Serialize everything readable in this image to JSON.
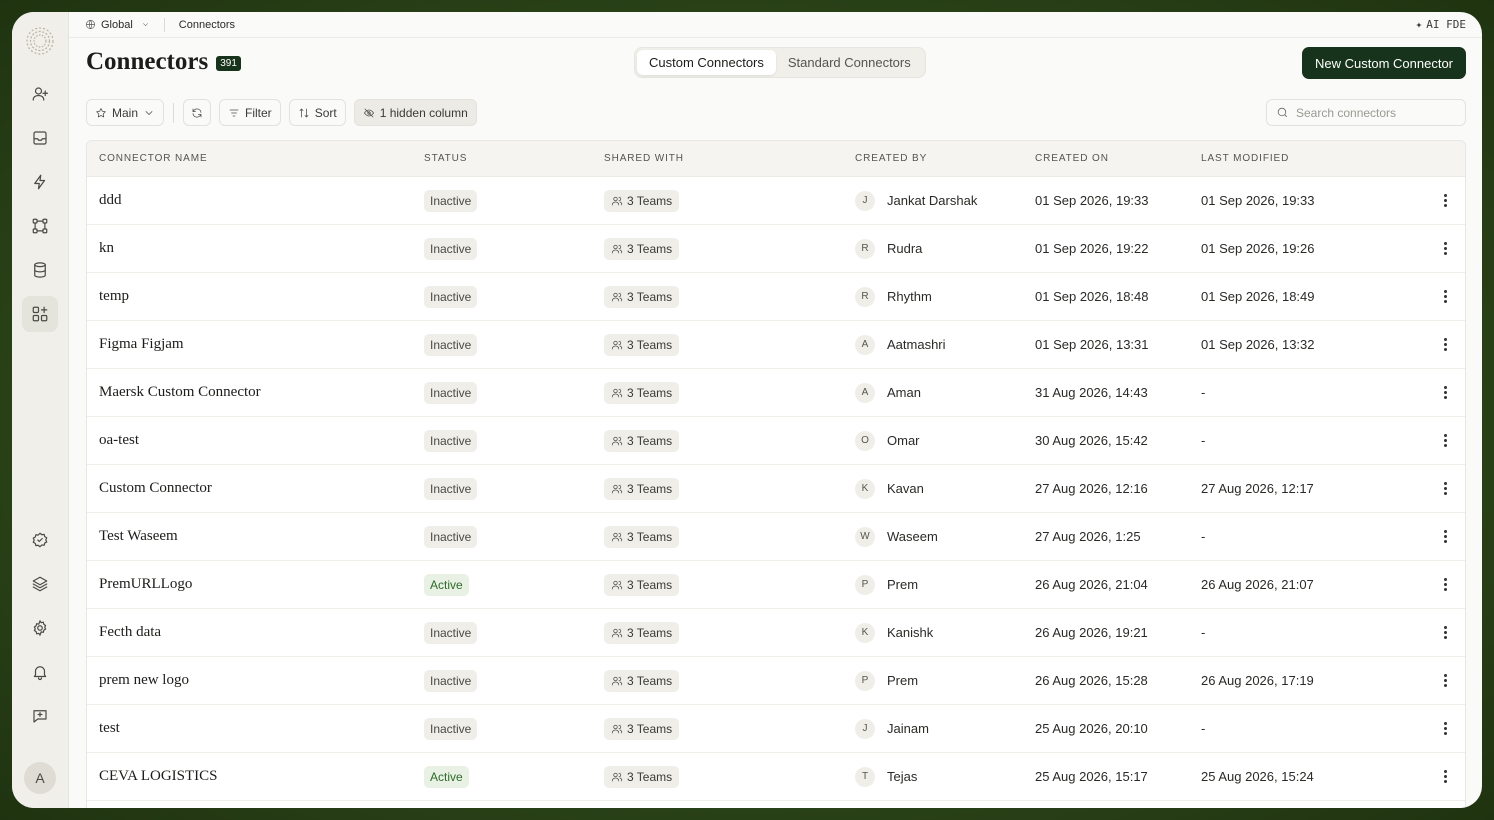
{
  "breadcrumb": {
    "scope": "Global",
    "page": "Connectors"
  },
  "top_right": {
    "label": "AI FDE"
  },
  "header": {
    "title": "Connectors",
    "count": "391"
  },
  "tabs": [
    {
      "label": "Custom Connectors",
      "active": true
    },
    {
      "label": "Standard Connectors",
      "active": false
    }
  ],
  "new_button": {
    "label": "New Custom Connector"
  },
  "toolbar": {
    "view_label": "Main",
    "filter_label": "Filter",
    "sort_label": "Sort",
    "hidden_label": "1 hidden column"
  },
  "search": {
    "placeholder": "Search connectors"
  },
  "table": {
    "headers": {
      "name": "Connector Name",
      "status": "Status",
      "shared": "Shared With",
      "created_by": "Created By",
      "created_on": "Created On",
      "modified": "Last Modified"
    },
    "rows": [
      {
        "name": "ddd",
        "status": "Inactive",
        "shared": "3 Teams",
        "initial": "J",
        "creator": "Jankat Darshak",
        "created": "01 Sep 2026, 19:33",
        "modified": "01 Sep 2026, 19:33"
      },
      {
        "name": "kn",
        "status": "Inactive",
        "shared": "3 Teams",
        "initial": "R",
        "creator": "Rudra",
        "created": "01 Sep 2026, 19:22",
        "modified": "01 Sep 2026, 19:26"
      },
      {
        "name": "temp",
        "status": "Inactive",
        "shared": "3 Teams",
        "initial": "R",
        "creator": "Rhythm",
        "created": "01 Sep 2026, 18:48",
        "modified": "01 Sep 2026, 18:49"
      },
      {
        "name": "Figma Figjam",
        "status": "Inactive",
        "shared": "3 Teams",
        "initial": "A",
        "creator": "Aatmashri",
        "created": "01 Sep 2026, 13:31",
        "modified": "01 Sep 2026, 13:32"
      },
      {
        "name": "Maersk Custom Connector",
        "status": "Inactive",
        "shared": "3 Teams",
        "initial": "A",
        "creator": "Aman",
        "created": "31 Aug 2026, 14:43",
        "modified": "-"
      },
      {
        "name": "oa-test",
        "status": "Inactive",
        "shared": "3 Teams",
        "initial": "O",
        "creator": "Omar",
        "created": "30 Aug 2026, 15:42",
        "modified": "-"
      },
      {
        "name": "Custom Connector",
        "status": "Inactive",
        "shared": "3 Teams",
        "initial": "K",
        "creator": "Kavan",
        "created": "27 Aug 2026, 12:16",
        "modified": "27 Aug 2026, 12:17"
      },
      {
        "name": "Test Waseem",
        "status": "Inactive",
        "shared": "3 Teams",
        "initial": "W",
        "creator": "Waseem",
        "created": "27 Aug 2026, 1:25",
        "modified": "-"
      },
      {
        "name": "PremURLLogo",
        "status": "Active",
        "shared": "3 Teams",
        "initial": "P",
        "creator": "Prem",
        "created": "26 Aug 2026, 21:04",
        "modified": "26 Aug 2026, 21:07"
      },
      {
        "name": "Fecth data",
        "status": "Inactive",
        "shared": "3 Teams",
        "initial": "K",
        "creator": "Kanishk",
        "created": "26 Aug 2026, 19:21",
        "modified": "-"
      },
      {
        "name": "prem new logo",
        "status": "Inactive",
        "shared": "3 Teams",
        "initial": "P",
        "creator": "Prem",
        "created": "26 Aug 2026, 15:28",
        "modified": "26 Aug 2026, 17:19"
      },
      {
        "name": "test",
        "status": "Inactive",
        "shared": "3 Teams",
        "initial": "J",
        "creator": "Jainam",
        "created": "25 Aug 2026, 20:10",
        "modified": "-"
      },
      {
        "name": "CEVA LOGISTICS",
        "status": "Active",
        "shared": "3 Teams",
        "initial": "T",
        "creator": "Tejas",
        "created": "25 Aug 2026, 15:17",
        "modified": "25 Aug 2026, 15:24"
      }
    ]
  },
  "user": {
    "initial": "A"
  },
  "colors": {
    "accent": "#17331c",
    "active_status": "#2e6b2a",
    "frame_bg": "#2c4519"
  }
}
